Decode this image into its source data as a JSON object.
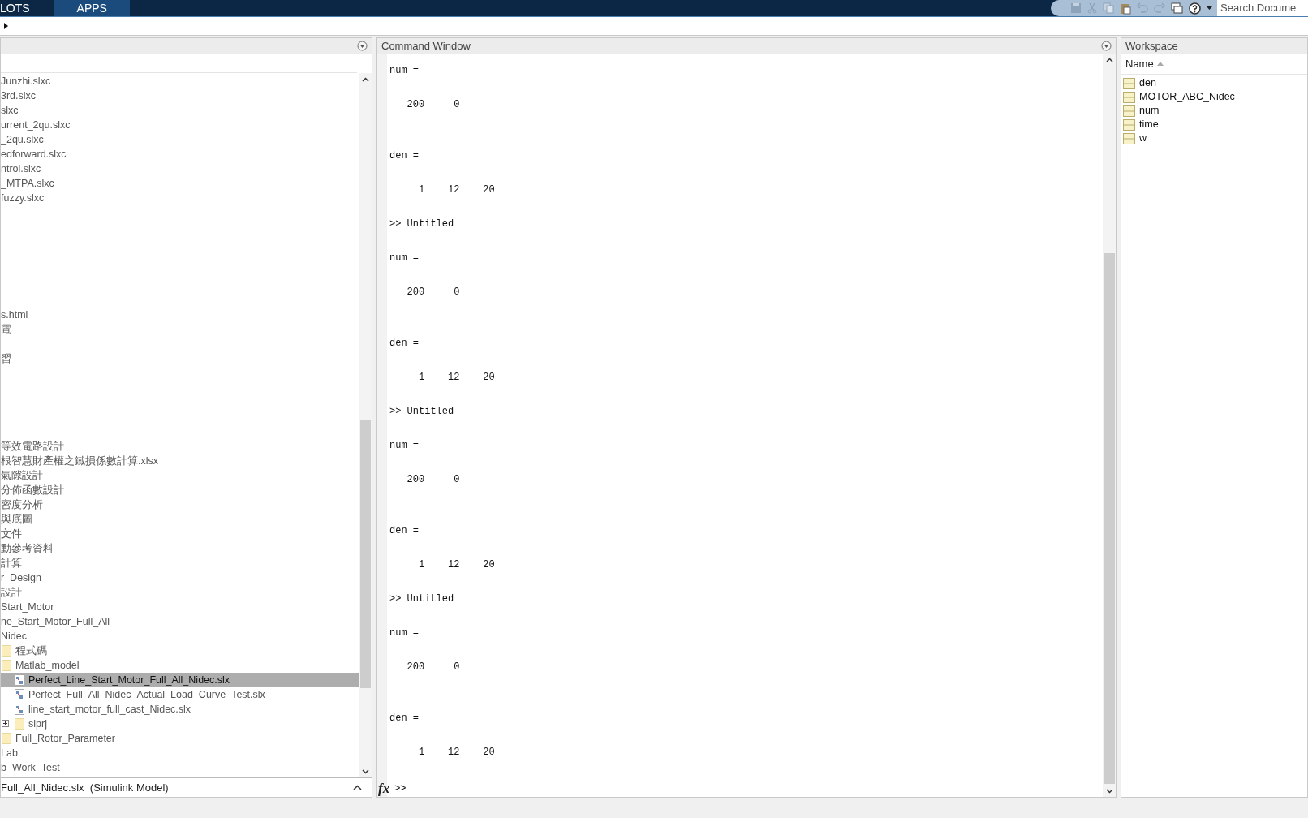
{
  "ribbon": {
    "tabs": [
      {
        "label": "LOTS",
        "selected": false
      },
      {
        "label": "APPS",
        "selected": true
      }
    ],
    "search": {
      "placeholder": "Search Docume"
    }
  },
  "file_browser": {
    "tree": [
      {
        "kind": "plain",
        "label": "Junzhi.slxc",
        "selected": false
      },
      {
        "kind": "plain",
        "label": "3rd.slxc",
        "selected": false
      },
      {
        "kind": "plain",
        "label": "slxc",
        "selected": false
      },
      {
        "kind": "plain",
        "label": "urrent_2qu.slxc",
        "selected": false
      },
      {
        "kind": "plain",
        "label": "_2qu.slxc",
        "selected": false
      },
      {
        "kind": "plain",
        "label": "edforward.slxc",
        "selected": false
      },
      {
        "kind": "plain",
        "label": "ntrol.slxc",
        "selected": false
      },
      {
        "kind": "plain",
        "label": "_MTPA.slxc",
        "selected": false
      },
      {
        "kind": "plain",
        "label": "fuzzy.slxc",
        "selected": false
      },
      {
        "kind": "clipped"
      },
      {
        "kind": "clipped"
      },
      {
        "kind": "clipped"
      },
      {
        "kind": "clipped"
      },
      {
        "kind": "clipped"
      },
      {
        "kind": "clipped"
      },
      {
        "kind": "clipped"
      },
      {
        "kind": "plain",
        "label": "s.html",
        "selected": false
      },
      {
        "kind": "plain",
        "label": "電",
        "selected": false
      },
      {
        "kind": "clipped"
      },
      {
        "kind": "plain",
        "label": "習",
        "selected": false
      },
      {
        "kind": "clipped"
      },
      {
        "kind": "clipped"
      },
      {
        "kind": "clipped"
      },
      {
        "kind": "clipped"
      },
      {
        "kind": "clipped"
      },
      {
        "kind": "plain",
        "label": "等效電路設計",
        "selected": false
      },
      {
        "kind": "plain",
        "label": "根智慧財產權之鐵損係數計算.xlsx",
        "selected": false
      },
      {
        "kind": "plain",
        "label": "氣隙設計",
        "selected": false
      },
      {
        "kind": "plain",
        "label": "分佈函數設計",
        "selected": false
      },
      {
        "kind": "plain",
        "label": "密度分析",
        "selected": false
      },
      {
        "kind": "plain",
        "label": "與底圖",
        "selected": false
      },
      {
        "kind": "plain",
        "label": "文件",
        "selected": false
      },
      {
        "kind": "plain",
        "label": "動參考資料",
        "selected": false
      },
      {
        "kind": "plain",
        "label": "計算",
        "selected": false
      },
      {
        "kind": "plain",
        "label": "r_Design",
        "selected": false
      },
      {
        "kind": "plain",
        "label": "設計",
        "selected": false
      },
      {
        "kind": "plain",
        "label": "Start_Motor",
        "selected": false
      },
      {
        "kind": "plain",
        "label": "ne_Start_Motor_Full_All",
        "selected": false
      },
      {
        "kind": "plain",
        "label": "Nidec",
        "selected": false,
        "children": [
          {
            "kind": "folder",
            "label": "程式碼",
            "selected": false
          },
          {
            "kind": "folder",
            "label": "Matlab_model",
            "selected": false,
            "children": [
              {
                "kind": "file",
                "label": "Perfect_Line_Start_Motor_Full_All_Nidec.slx",
                "selected": true
              },
              {
                "kind": "file",
                "label": "Perfect_Full_All_Nidec_Actual_Load_Curve_Test.slx",
                "selected": false
              },
              {
                "kind": "file",
                "label": "line_start_motor_full_cast_Nidec.slx",
                "selected": false
              },
              {
                "kind": "folder",
                "label": "slprj",
                "selected": false,
                "expanded": false
              }
            ]
          },
          {
            "kind": "folder",
            "label": "Full_Rotor_Parameter",
            "selected": false
          }
        ]
      },
      {
        "kind": "plain",
        "label": "Lab",
        "selected": false
      },
      {
        "kind": "plain",
        "label": "b_Work_Test",
        "selected": false
      }
    ],
    "details": "Full_All_Nidec.slx  (Simulink Model)"
  },
  "command_window": {
    "title": "Command Window",
    "output": [
      {
        "kind": "assign",
        "label": "num =",
        "value": "   200     0"
      },
      {
        "kind": "assign",
        "label": "den =",
        "value": "     1    12    20"
      },
      {
        "kind": "command",
        "text": ">> Untitled"
      },
      {
        "kind": "assign",
        "label": "num =",
        "value": "   200     0"
      },
      {
        "kind": "assign",
        "label": "den =",
        "value": "     1    12    20"
      },
      {
        "kind": "command",
        "text": ">> Untitled"
      },
      {
        "kind": "assign",
        "label": "num =",
        "value": "   200     0"
      },
      {
        "kind": "assign",
        "label": "den =",
        "value": "     1    12    20"
      },
      {
        "kind": "command",
        "text": ">> Untitled"
      },
      {
        "kind": "assign",
        "label": "num =",
        "value": "   200     0"
      },
      {
        "kind": "assign",
        "label": "den =",
        "value": "     1    12    20"
      }
    ],
    "fx": "fx",
    "prompt": ">>"
  },
  "workspace": {
    "title": "Workspace",
    "column": "Name",
    "variables": [
      "den",
      "MOTOR_ABC_Nidec",
      "num",
      "time",
      "w"
    ]
  }
}
